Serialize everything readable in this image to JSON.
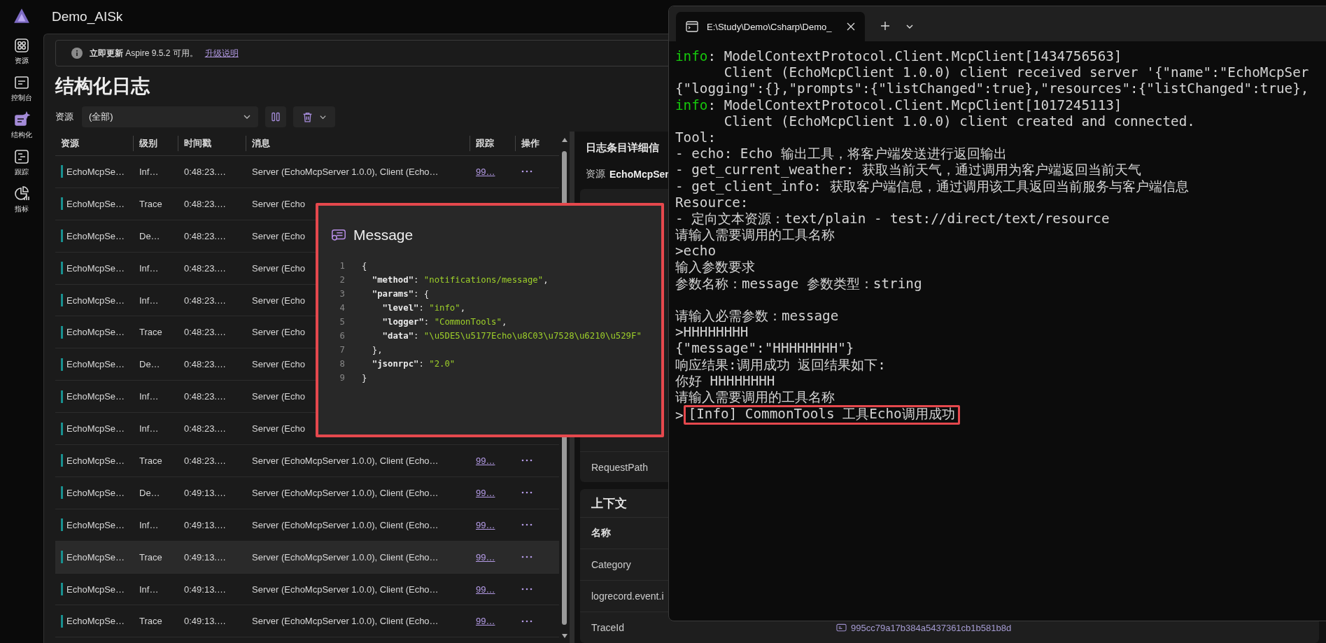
{
  "app": {
    "title": "Demo_AISk"
  },
  "nav": [
    {
      "label": "资源",
      "selected": false
    },
    {
      "label": "控制台",
      "selected": false
    },
    {
      "label": "结构化",
      "selected": true
    },
    {
      "label": "跟踪",
      "selected": false
    },
    {
      "label": "指标",
      "selected": false
    }
  ],
  "notice": {
    "bold": "立即更新",
    "text": "Aspire 9.5.2 可用。",
    "link": "升级说明"
  },
  "page_title": "结构化日志",
  "filter": {
    "label": "资源",
    "value": "(全部)"
  },
  "table": {
    "columns": [
      "资源",
      "级别",
      "时间戳",
      "消息",
      "跟踪",
      "操作"
    ],
    "rows": [
      {
        "resource": "EchoMcpSe…",
        "level": "Inf…",
        "time": "0:48:23.…",
        "message": "Server (EchoMcpServer 1.0.0), Client (Echo…",
        "trace": "99…",
        "selected": false
      },
      {
        "resource": "EchoMcpSe…",
        "level": "Trace",
        "time": "0:48:23.…",
        "message": "Server (Echo",
        "selected": false
      },
      {
        "resource": "EchoMcpSe…",
        "level": "De…",
        "time": "0:48:23.…",
        "message": "Server (Echo",
        "selected": false
      },
      {
        "resource": "EchoMcpSe…",
        "level": "Inf…",
        "time": "0:48:23.…",
        "message": "Server (Echo",
        "selected": false
      },
      {
        "resource": "EchoMcpSe…",
        "level": "Inf…",
        "time": "0:48:23.…",
        "message": "Server (Echo",
        "selected": false
      },
      {
        "resource": "EchoMcpSe…",
        "level": "Trace",
        "time": "0:48:23.…",
        "message": "Server (Echo",
        "selected": false
      },
      {
        "resource": "EchoMcpSe…",
        "level": "De…",
        "time": "0:48:23.…",
        "message": "Server (Echo",
        "selected": false
      },
      {
        "resource": "EchoMcpSe…",
        "level": "Inf…",
        "time": "0:48:23.…",
        "message": "Server (Echo",
        "selected": false
      },
      {
        "resource": "EchoMcpSe…",
        "level": "Inf…",
        "time": "0:48:23.…",
        "message": "Server (Echo",
        "selected": false
      },
      {
        "resource": "EchoMcpSe…",
        "level": "Trace",
        "time": "0:48:23.…",
        "message": "Server (EchoMcpServer 1.0.0), Client (Echo…",
        "trace": "99…",
        "selected": false
      },
      {
        "resource": "EchoMcpSe…",
        "level": "De…",
        "time": "0:49:13.…",
        "message": "Server (EchoMcpServer 1.0.0), Client (Echo…",
        "trace": "99…",
        "selected": false
      },
      {
        "resource": "EchoMcpSe…",
        "level": "Inf…",
        "time": "0:49:13.…",
        "message": "Server (EchoMcpServer 1.0.0), Client (Echo…",
        "trace": "99…",
        "selected": false
      },
      {
        "resource": "EchoMcpSe…",
        "level": "Trace",
        "time": "0:49:13.…",
        "message": "Server (EchoMcpServer 1.0.0), Client (Echo…",
        "trace": "99…",
        "selected": true
      },
      {
        "resource": "EchoMcpSe…",
        "level": "Inf…",
        "time": "0:49:13.…",
        "message": "Server (EchoMcpServer 1.0.0), Client (Echo…",
        "trace": "99…",
        "selected": false
      },
      {
        "resource": "EchoMcpSe…",
        "level": "Trace",
        "time": "0:49:13.…",
        "message": "Server (EchoMcpServer 1.0.0), Client (Echo…",
        "trace": "99…",
        "selected": false
      }
    ]
  },
  "details": {
    "title": "日志条目详细信",
    "resource_label": "资源",
    "resource_value": "EchoMcpSer",
    "properties": [
      "RequestPath"
    ],
    "context": {
      "title": "上下文",
      "column": "名称",
      "rows": [
        {
          "name": "Category"
        },
        {
          "name": "logrecord.event.i"
        },
        {
          "name": "TraceId",
          "value": "995cc79a17b384a5437361cb1b581b8d"
        }
      ]
    }
  },
  "message_popup": {
    "title": "Message",
    "lines": [
      {
        "number": "1",
        "tokens": [
          {
            "kind": "punct",
            "text": "{"
          }
        ]
      },
      {
        "number": "2",
        "tokens": [
          {
            "kind": "key",
            "text": "  \"method\""
          },
          {
            "kind": "punct",
            "text": ": "
          },
          {
            "kind": "string",
            "text": "\"notifications/message\""
          },
          {
            "kind": "punct",
            "text": ","
          }
        ]
      },
      {
        "number": "3",
        "tokens": [
          {
            "kind": "key",
            "text": "  \"params\""
          },
          {
            "kind": "punct",
            "text": ": {"
          }
        ]
      },
      {
        "number": "4",
        "tokens": [
          {
            "kind": "key",
            "text": "    \"level\""
          },
          {
            "kind": "punct",
            "text": ": "
          },
          {
            "kind": "string",
            "text": "\"info\""
          },
          {
            "kind": "punct",
            "text": ","
          }
        ]
      },
      {
        "number": "5",
        "tokens": [
          {
            "kind": "key",
            "text": "    \"logger\""
          },
          {
            "kind": "punct",
            "text": ": "
          },
          {
            "kind": "string",
            "text": "\"CommonTools\""
          },
          {
            "kind": "punct",
            "text": ","
          }
        ]
      },
      {
        "number": "6",
        "tokens": [
          {
            "kind": "key",
            "text": "    \"data\""
          },
          {
            "kind": "punct",
            "text": ": "
          },
          {
            "kind": "string",
            "text": "\"\\u5DE5\\u5177Echo\\u8C03\\u7528\\u6210\\u529F\""
          }
        ]
      },
      {
        "number": "7",
        "tokens": [
          {
            "kind": "punct",
            "text": "  },"
          }
        ]
      },
      {
        "number": "8",
        "tokens": [
          {
            "kind": "key",
            "text": "  \"jsonrpc\""
          },
          {
            "kind": "punct",
            "text": ": "
          },
          {
            "kind": "string",
            "text": "\"2.0\""
          }
        ]
      },
      {
        "number": "9",
        "tokens": [
          {
            "kind": "punct",
            "text": "}"
          }
        ]
      }
    ]
  },
  "terminal": {
    "tab_title": "E:\\Study\\Demo\\Csharp\\Demo_",
    "lines": [
      {
        "kind": "log",
        "tag": "info",
        "text": ": ModelContextProtocol.Client.McpClient[1434756563]"
      },
      {
        "kind": "indent",
        "text": "Client (EchoMcpClient 1.0.0) client received server '{\"name\":\"EchoMcpSer"
      },
      {
        "kind": "text",
        "text": "{\"logging\":{},\"prompts\":{\"listChanged\":true},\"resources\":{\"listChanged\":true},"
      },
      {
        "kind": "log",
        "tag": "info",
        "text": ": ModelContextProtocol.Client.McpClient[1017245113]"
      },
      {
        "kind": "indent",
        "text": "Client (EchoMcpClient 1.0.0) client created and connected."
      },
      {
        "kind": "text",
        "text": "Tool:"
      },
      {
        "kind": "text",
        "text": "- echo: Echo 输出工具，将客户端发送进行返回输出"
      },
      {
        "kind": "text",
        "text": "- get_current_weather: 获取当前天气，通过调用为客户端返回当前天气"
      },
      {
        "kind": "text",
        "text": "- get_client_info: 获取客户端信息，通过调用该工具返回当前服务与客户端信息"
      },
      {
        "kind": "text",
        "text": "Resource:"
      },
      {
        "kind": "text",
        "text": "- 定向文本资源：text/plain - test://direct/text/resource"
      },
      {
        "kind": "text",
        "text": "请输入需要调用的工具名称"
      },
      {
        "kind": "text",
        "text": ">echo"
      },
      {
        "kind": "text",
        "text": "输入参数要求"
      },
      {
        "kind": "text",
        "text": "参数名称：message 参数类型：string"
      },
      {
        "kind": "blank"
      },
      {
        "kind": "text",
        "text": "请输入必需参数：message"
      },
      {
        "kind": "text",
        "text": ">HHHHHHHH"
      },
      {
        "kind": "text",
        "text": "{\"message\":\"HHHHHHHH\"}"
      },
      {
        "kind": "text",
        "text": "响应结果:调用成功 返回结果如下:"
      },
      {
        "kind": "text",
        "text": "你好 HHHHHHHH"
      },
      {
        "kind": "text",
        "text": "请输入需要调用的工具名称"
      },
      {
        "kind": "boxed",
        "prompt": ">",
        "text": "[Info] CommonTools 工具Echo调用成功"
      }
    ]
  }
}
